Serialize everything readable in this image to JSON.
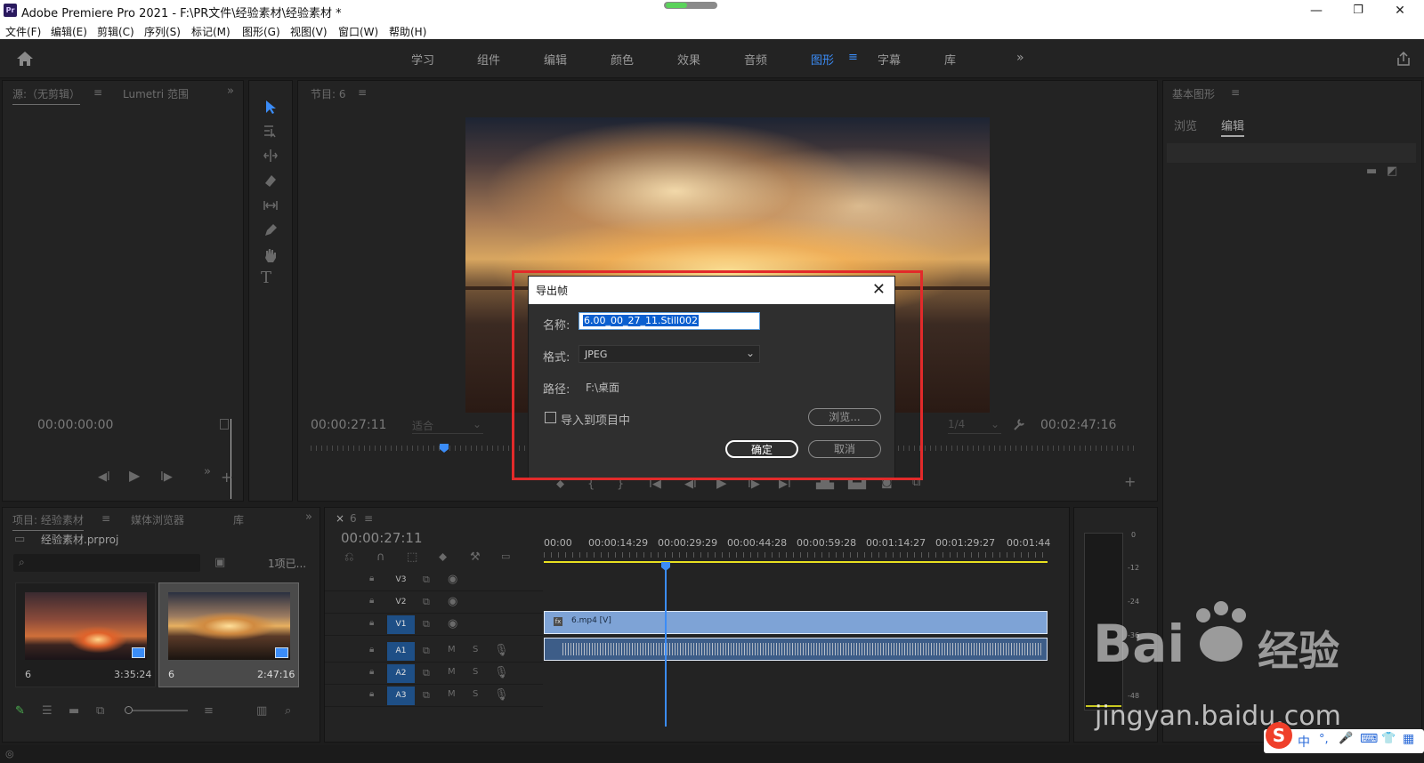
{
  "window": {
    "app_icon": "Pr",
    "title": "Adobe Premiere Pro 2021 - F:\\PR文件\\经验素材\\经验素材 *",
    "minimize": "—",
    "restore": "❐",
    "close": "✕"
  },
  "menubar": [
    "文件(F)",
    "编辑(E)",
    "剪辑(C)",
    "序列(S)",
    "标记(M)",
    "图形(G)",
    "视图(V)",
    "窗口(W)",
    "帮助(H)"
  ],
  "workspaces": {
    "items": [
      "学习",
      "组件",
      "编辑",
      "颜色",
      "效果",
      "音频",
      "图形",
      "字幕",
      "库"
    ],
    "active": "图形",
    "more": "»"
  },
  "source_panel": {
    "tabs": [
      "源:（无剪辑）",
      "Lumetri 范围"
    ],
    "timecode": "00:00:00:00"
  },
  "program_panel": {
    "tab": "节目: 6",
    "timecode_left": "00:00:27:11",
    "fit": "适合",
    "quality": "1/4",
    "timecode_right": "00:02:47:16"
  },
  "essential_graphics": {
    "tab": "基本图形",
    "subtabs": [
      "浏览",
      "编辑"
    ],
    "active_subtab": "编辑"
  },
  "project_panel": {
    "tabs": [
      "项目: 经验素材",
      "媒体浏览器",
      "库"
    ],
    "project_file": "经验素材.prproj",
    "item_count": "1项已...",
    "clips": [
      {
        "name": "6",
        "duration": "3:35:24"
      },
      {
        "name": "6",
        "duration": "2:47:16"
      }
    ]
  },
  "timeline": {
    "tab": "6",
    "timecode": "00:00:27:11",
    "ruler": [
      "00:00",
      "00:00:14:29",
      "00:00:29:29",
      "00:00:44:28",
      "00:00:59:28",
      "00:01:14:27",
      "00:01:29:27",
      "00:01:44"
    ],
    "video_tracks": [
      "V3",
      "V2",
      "V1"
    ],
    "audio_tracks": [
      "A1",
      "A2",
      "A3"
    ],
    "track_m": "M",
    "track_s": "S",
    "clip_label": "6.mp4 [V]",
    "clip_fx": "fx"
  },
  "audio_meter": {
    "scale": [
      "0",
      "-12",
      "-24",
      "-36",
      "-48"
    ]
  },
  "dialog": {
    "title": "导出帧",
    "name_label": "名称:",
    "name_value": "6.00_00_27_11.Still002",
    "format_label": "格式:",
    "format_value": "JPEG",
    "path_label": "路径:",
    "path_value": "F:\\桌面",
    "import_checkbox": "导入到项目中",
    "browse": "浏览...",
    "ok": "确定",
    "cancel": "取消"
  },
  "watermark": {
    "logo": "Bai",
    "logo_cn": "经验",
    "url": "jingyan.baidu.com"
  },
  "ime_toolbar": {
    "logo": "S",
    "items": [
      "中",
      "°,",
      "🎤",
      "⌨",
      "👕",
      "▦"
    ]
  },
  "colors": {
    "accent": "#3b8cf7",
    "highlight": "#e22a2a",
    "selection": "#0b5fcf",
    "clip": "#7ea3d6",
    "track_active": "#1e4f86"
  }
}
